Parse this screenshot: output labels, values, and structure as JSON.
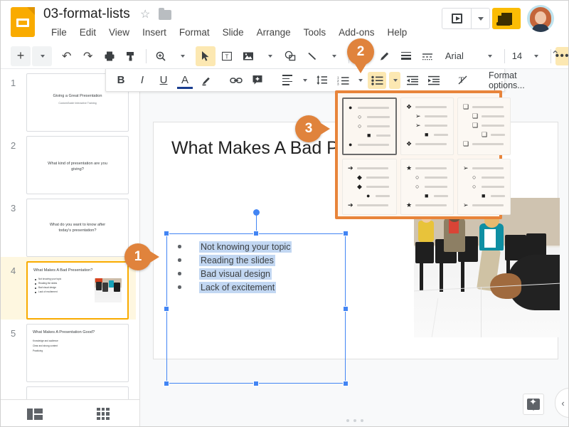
{
  "app": {
    "doc_title": "03-format-lists",
    "logo_icon": "google-slides-logo",
    "star_icon": "☆",
    "folder_icon": "folder-icon"
  },
  "menu": {
    "items": [
      "File",
      "Edit",
      "View",
      "Insert",
      "Format",
      "Slide",
      "Arrange",
      "Tools",
      "Add-ons",
      "Help"
    ]
  },
  "header_actions": {
    "present_label": "Present",
    "present_caret": "▾",
    "share_label": "Share",
    "avatar_label": "Account"
  },
  "toolbar": {
    "items": [
      {
        "name": "new-slide-button",
        "glyph": "+"
      },
      {
        "name": "new-slide-caret",
        "glyph": "▾"
      },
      {
        "name": "undo-button",
        "glyph": "↶"
      },
      {
        "name": "redo-button",
        "glyph": "↷"
      },
      {
        "name": "print-button",
        "glyph": "print-icon"
      },
      {
        "name": "paint-format-button",
        "glyph": "paint-format-icon"
      },
      {
        "name": "zoom-button",
        "glyph": "zoom-icon"
      },
      {
        "name": "zoom-caret",
        "glyph": "▾"
      },
      {
        "name": "select-tool-button",
        "glyph": "cursor-icon"
      },
      {
        "name": "text-box-button",
        "glyph": "text-box-icon"
      },
      {
        "name": "insert-image-button",
        "glyph": "image-icon"
      },
      {
        "name": "insert-image-caret",
        "glyph": "▾"
      },
      {
        "name": "shape-button",
        "glyph": "shape-icon"
      },
      {
        "name": "line-button",
        "glyph": "line-icon"
      },
      {
        "name": "line-caret",
        "glyph": "▾"
      },
      {
        "name": "fill-color-button",
        "glyph": "fill-icon"
      },
      {
        "name": "border-color-button",
        "glyph": "pen-icon"
      },
      {
        "name": "border-weight-button",
        "glyph": "border-weight-icon"
      },
      {
        "name": "border-dash-button",
        "glyph": "border-dash-icon"
      }
    ],
    "font_family": "Arial",
    "font_size": "14",
    "more_label": "•••",
    "collapse_glyph": "⌃"
  },
  "format_bar": {
    "bold": "B",
    "italic": "I",
    "underline": "U",
    "text_color": "A",
    "highlight": "highlight-icon",
    "link": "link-icon",
    "comment": "comment-icon",
    "align": "align-icon",
    "align_caret": "▾",
    "line_spacing": "line-spacing-icon",
    "numbered_list": "numbered-list-icon",
    "numbered_list_caret": "▾",
    "bulleted_list": "bulleted-list-icon",
    "bulleted_list_caret": "▾",
    "decrease_indent": "decrease-indent-icon",
    "increase_indent": "increase-indent-icon",
    "clear_formatting": "clear-formatting-icon",
    "format_options_label": "Format options..."
  },
  "bullet_panel": {
    "selected_index": 0,
    "options": [
      {
        "name": "bullet-style-disc-circle-square",
        "marks": [
          "●",
          "○",
          "○",
          "■",
          "●"
        ]
      },
      {
        "name": "bullet-style-diamond-arrow-square",
        "marks": [
          "❖",
          "➢",
          "➢",
          "■",
          "❖"
        ]
      },
      {
        "name": "bullet-style-hollow-square",
        "marks": [
          "❑",
          "❑",
          "❑",
          "❑",
          "❑"
        ]
      },
      {
        "name": "bullet-style-arrow-diamond-circle",
        "marks": [
          "➔",
          "◆",
          "◆",
          "●",
          "➔"
        ]
      },
      {
        "name": "bullet-style-star-circle-square",
        "marks": [
          "★",
          "○",
          "○",
          "■",
          "★"
        ]
      },
      {
        "name": "bullet-style-arrowhead-circle-square",
        "marks": [
          "➢",
          "○",
          "○",
          "■",
          "➢"
        ]
      }
    ]
  },
  "sidebar": {
    "slides": [
      {
        "number": "1",
        "title": "Giving a Great Presentation",
        "subtitle": "CustomGuide Interactive Training",
        "selected": false,
        "layout": "title"
      },
      {
        "number": "2",
        "title": "What kind of presentation are you giving?",
        "subtitle": "",
        "selected": false,
        "layout": "center"
      },
      {
        "number": "3",
        "title": "What do you want to know after today's presentation?",
        "subtitle": "",
        "selected": false,
        "layout": "center"
      },
      {
        "number": "4",
        "title": "What Makes A Bad Presentation?",
        "subtitle": "",
        "selected": true,
        "layout": "bullets-image",
        "bullets": [
          "Not knowing your topic",
          "Reading the slides",
          "Bad visual design",
          "Lack of excitement"
        ]
      },
      {
        "number": "5",
        "title": "What Makes A Presentation Good?",
        "subtitle": "",
        "selected": false,
        "layout": "lines",
        "bullets": [
          "Knowledge and audience",
          "Clear and strong content",
          "Practicing"
        ]
      }
    ],
    "filmstrip_view_icon": "filmstrip-view-icon",
    "grid_view_icon": "grid-view-icon"
  },
  "slide": {
    "title": "What Makes A Bad Pre",
    "bullets": [
      "Not knowing your topic",
      "Reading the slides",
      "Bad visual design",
      "Lack of excitement"
    ],
    "image_alt": "audience-seated-in-chairs-photo"
  },
  "canvas_actions": {
    "explore_label": "Explore",
    "side_panel_toggle": "‹"
  },
  "markers": [
    {
      "label": "1",
      "name": "callout-marker-1"
    },
    {
      "label": "2",
      "name": "callout-marker-2"
    },
    {
      "label": "3",
      "name": "callout-marker-3"
    }
  ],
  "colors": {
    "accent_orange": "#E0833C",
    "brand_yellow": "#F9AB00",
    "selection_blue": "#4285f4",
    "highlight_yellow": "#fce8b2"
  }
}
